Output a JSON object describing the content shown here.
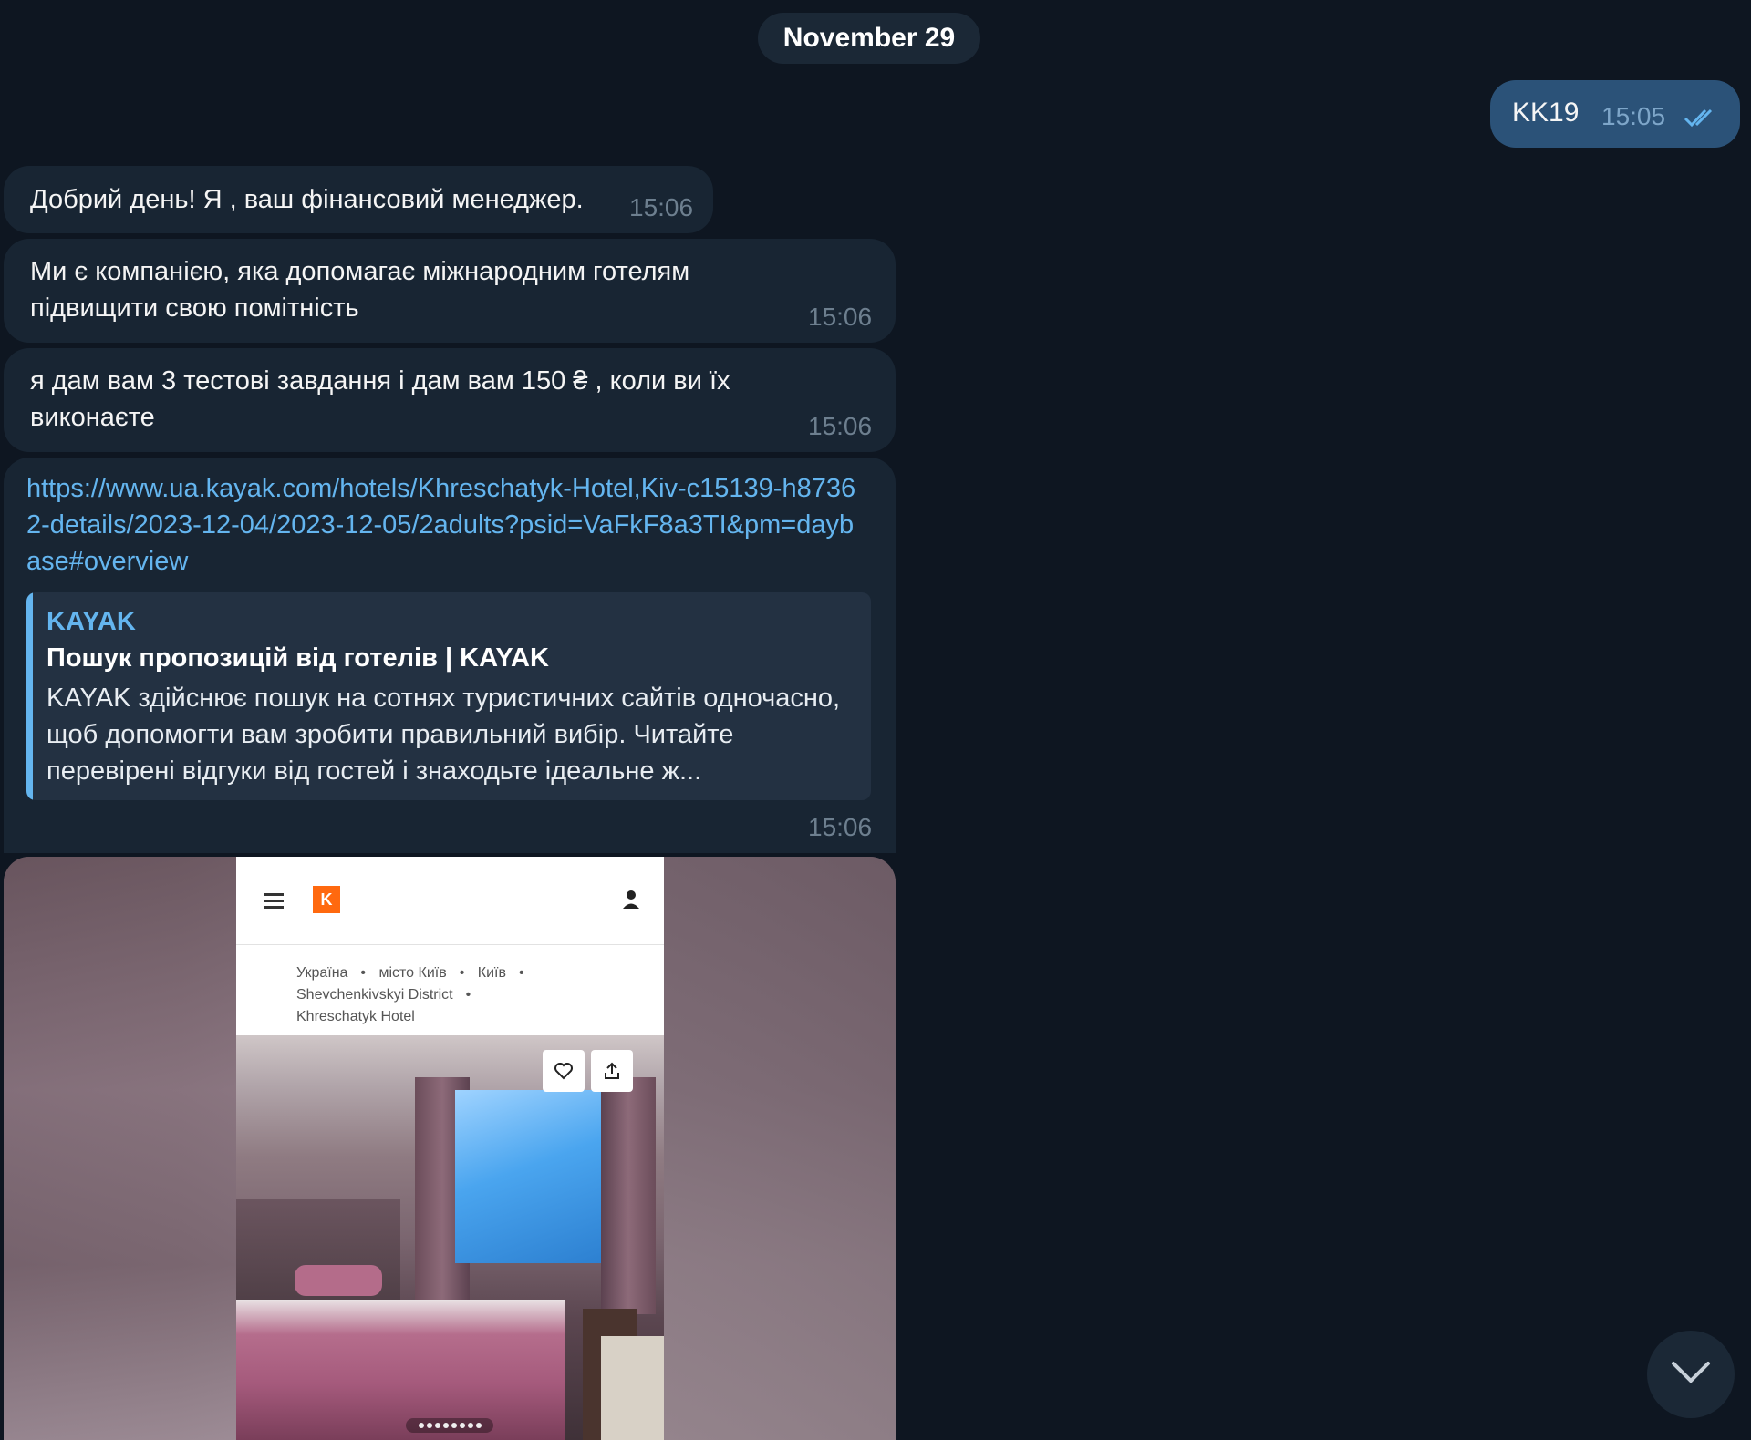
{
  "date_separator": "November 29",
  "messages": {
    "outgoing": {
      "text": "KK19",
      "time": "15:05"
    },
    "m1": {
      "text": "Добрий день! Я , ваш фінансовий менеджер.",
      "time": "15:06"
    },
    "m2": {
      "text": "Ми є компанією, яка допомагає міжнародним готелям\nпідвищити свою помітність",
      "time": "15:06"
    },
    "m3": {
      "text": "я дам вам 3 тестові завдання і дам вам 150 ₴ , коли ви їх\nвиконаєте",
      "time": "15:06"
    },
    "m4": {
      "link": "https://www.ua.kayak.com/hotels/Khreschatyk-Hotel,Kiv-c15139-h87362-details/2023-12-04/2023-12-05/2adults?psid=VaFkF8a3TI&pm=daybase#overview",
      "time": "15:06",
      "preview": {
        "site": "KAYAK",
        "title": "Пошук пропозицій від готелів | KAYAK",
        "description": "KAYAK здійснює пошук на сотнях туристичних сайтів одночасно, щоб допомогти вам зробити правильний вибір. Читайте перевірені відгуки від гостей і знаходьте ідеальне ж..."
      }
    }
  },
  "screenshot": {
    "logo": "K",
    "breadcrumbs": [
      "Україна",
      "місто Київ",
      "Київ",
      "Shevchenkivskyi District",
      "Khreschatyk Hotel"
    ]
  },
  "icons": {
    "read_check": "double-check-icon",
    "scroll_down": "chevron-down-icon",
    "heart": "heart-icon",
    "share": "share-icon",
    "menu": "menu-icon",
    "user": "user-icon"
  },
  "colors": {
    "background": "#0e1621",
    "incoming_bubble": "#182533",
    "outgoing_bubble": "#2b5278",
    "link": "#64b5ef",
    "kayak_orange": "#ff690f"
  }
}
